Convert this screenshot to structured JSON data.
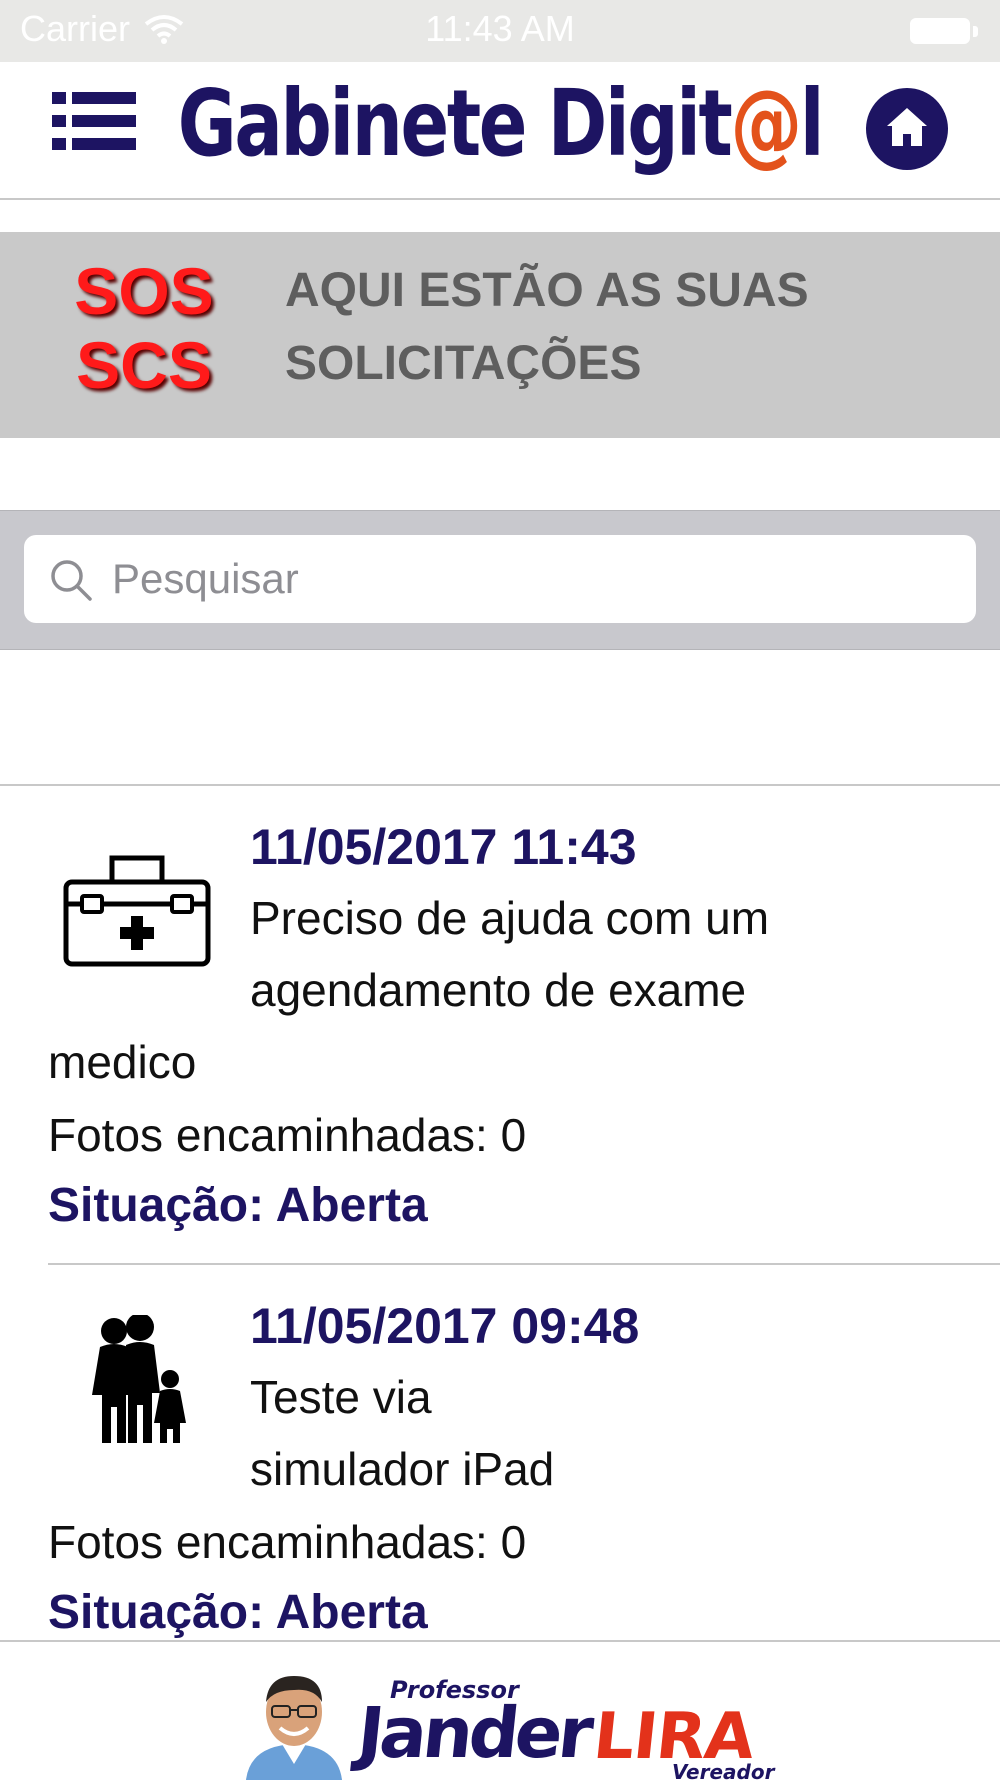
{
  "status_bar": {
    "carrier": "Carrier",
    "time": "11:43 AM",
    "icons": [
      "wifi-icon",
      "battery-icon"
    ]
  },
  "nav": {
    "title_prefix": "Gabinete Digit",
    "title_at": "@",
    "title_suffix": "l",
    "menu_icon": "list-menu-icon",
    "home_icon": "home-icon",
    "colors": {
      "brand": "#1d1462",
      "accent": "#e3521b"
    }
  },
  "banner": {
    "logo_line1": "SOS",
    "logo_line2": "SCS",
    "heading": "AQUI ESTÃO AS SUAS SOLICITAÇÕES"
  },
  "search": {
    "placeholder": "Pesquisar",
    "value": "",
    "icon": "search-icon"
  },
  "requests": [
    {
      "icon": "medical-kit-icon",
      "date": "11/05/2017 11:43",
      "desc_line1": "Preciso de ajuda com um",
      "desc_line2": "agendamento de exame",
      "desc_line3": "medico",
      "photos": "Fotos encaminhadas: 0",
      "status": "Situação: Aberta"
    },
    {
      "icon": "family-icon",
      "date": "11/05/2017 09:48",
      "desc_line1": "Teste via",
      "desc_line2": "simulador iPad",
      "photos": "Fotos encaminhadas: 0",
      "status": "Situação: Aberta"
    }
  ],
  "footer": {
    "title": "Professor",
    "name": "Jander",
    "surname": "LIRA",
    "role": "Vereador"
  }
}
